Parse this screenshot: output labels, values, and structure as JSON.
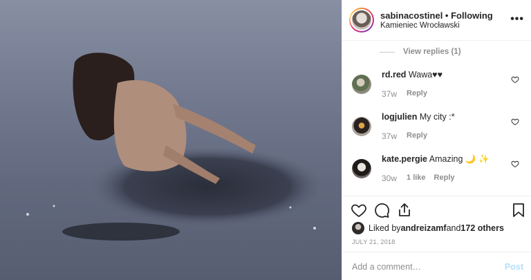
{
  "header": {
    "username": "sabinacostinel",
    "separator": " • ",
    "follow_status": "Following",
    "location": "Kamieniec Wrocławski",
    "more_icon": "more-horizontal-icon"
  },
  "view_replies": {
    "label": "View replies (1)"
  },
  "comments": [
    {
      "username": "rd.red",
      "text": " Wawa♥♥",
      "age": "37w",
      "likes": "",
      "reply": "Reply"
    },
    {
      "username": "logjulien",
      "text": " My city :*",
      "age": "37w",
      "likes": "",
      "reply": "Reply"
    },
    {
      "username": "kate.pergie",
      "text": " Amazing 🌙 ✨",
      "age": "30w",
      "likes": "1 like",
      "reply": "Reply"
    }
  ],
  "actions": {
    "icons": [
      "heart-icon",
      "comment-icon",
      "share-icon",
      "bookmark-icon"
    ],
    "liked_prefix": "Liked by ",
    "liked_user": "andreizamf",
    "liked_and": " and ",
    "liked_others": "172 others",
    "date": "JULY 21, 2018"
  },
  "add_comment": {
    "placeholder": "Add a comment…",
    "post_label": "Post"
  },
  "colors": {
    "link_blue": "#b2dffc",
    "muted": "#8e8e8e",
    "text": "#262626"
  }
}
